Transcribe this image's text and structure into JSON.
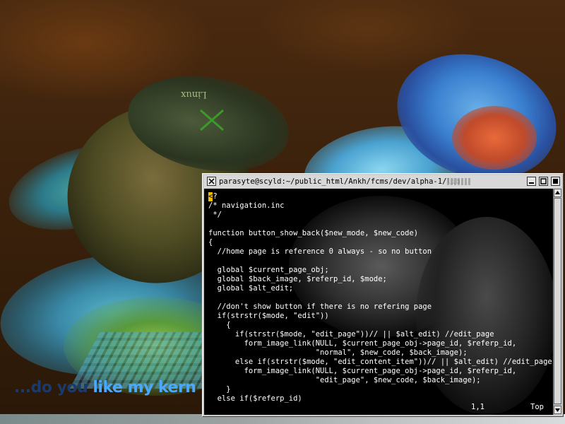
{
  "wallpaper": {
    "logo_text": "Linux",
    "slogan_prefix": "...do you ",
    "slogan_highlight": "like my kern",
    "slogan_color": "#4aa8ff"
  },
  "terminal": {
    "title": "parasyte@scyld:~/public_html/Ankh/fcms/dev/alpha-1/lib",
    "menu_icon": "close-x-icon",
    "buttons": {
      "minimize_icon": "minimize-icon",
      "maximize_icon": "maximize-icon",
      "close_icon": "close-icon"
    },
    "cursor_char": "<",
    "first_line_rest": "?",
    "lines": [
      "/* navigation.inc",
      " */",
      "",
      "function button_show_back($new_mode, $new_code)",
      "{",
      "  //home page is reference 0 always - so no button",
      "",
      "  global $current_page_obj;",
      "  global $back_image, $referp_id, $mode;",
      "  global $alt_edit;",
      "",
      "  //don't show button if there is no refering page",
      "  if(strstr($mode, \"edit\"))",
      "    {",
      "      if(strstr($mode, \"edit_page\"))// || $alt_edit) //edit_page",
      "        form_image_link(NULL, $current_page_obj->page_id, $referp_id,",
      "                        \"normal\", $new_code, $back_image);",
      "      else if(strstr($mode, \"edit_content_item\"))// || $alt_edit) //edit_page",
      "        form_image_link(NULL, $current_page_obj->page_id, $referp_id,",
      "                        \"edit_page\", $new_code, $back_image);",
      "    }",
      "  else if($referp_id)"
    ],
    "status_position": "1,1",
    "status_scroll": "Top",
    "scrollbar": {
      "up_icon": "arrow-up-icon",
      "down_icon": "arrow-down-icon"
    }
  }
}
